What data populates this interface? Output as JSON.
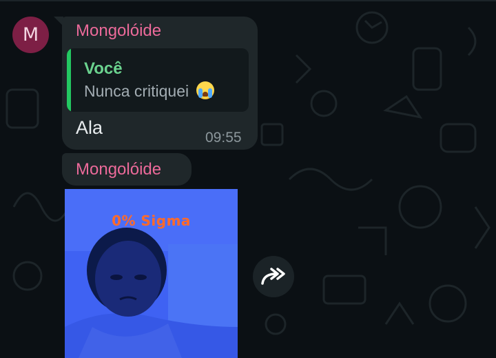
{
  "chat": {
    "messages": [
      {
        "sender": "Mongolóide",
        "avatar_initial": "M",
        "quote": {
          "author": "Você",
          "text": "Nunca critiquei"
        },
        "text": "Ala",
        "time": "09:55"
      },
      {
        "sender": "Mongolóide",
        "media": {
          "caption": "0% Sigma"
        }
      }
    ]
  },
  "icons": {
    "forward": "forward-icon",
    "emoji": "crying-face-emoji"
  },
  "colors": {
    "background": "#0b1014",
    "bubble": "#1f272a",
    "sender_name": "#ec6a9a",
    "quote_accent": "#23c861",
    "quote_author": "#6bd38f",
    "media_background": "#3a5df0",
    "media_caption": "#ff6a2a"
  }
}
